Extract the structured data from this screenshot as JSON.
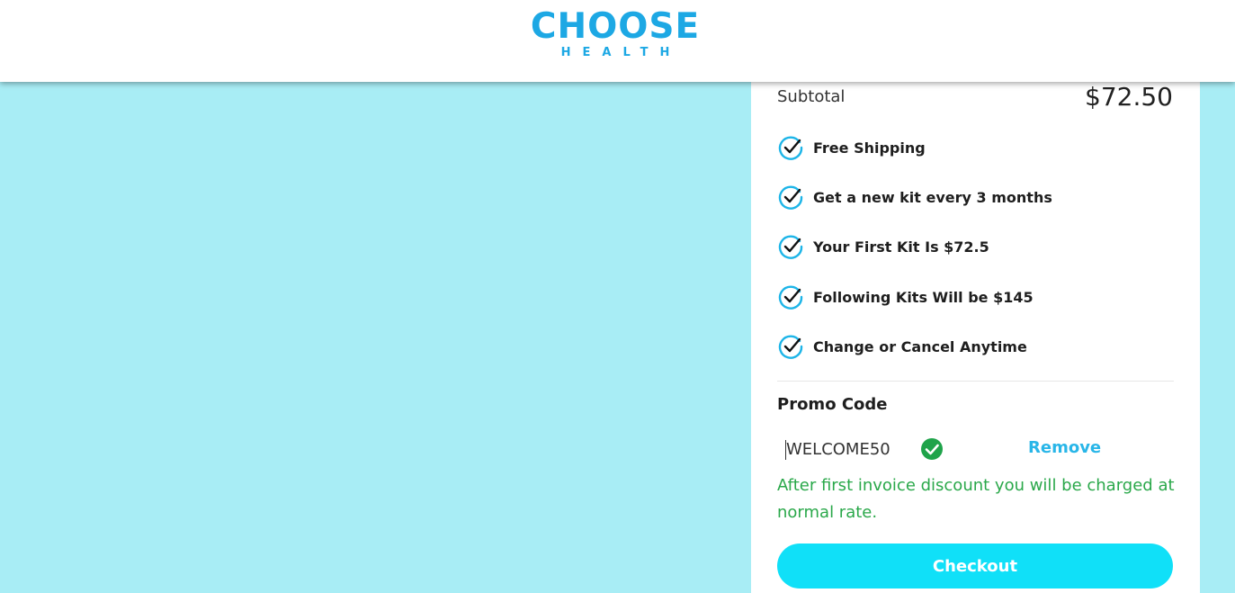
{
  "header": {
    "logo_text": "CHOOSE",
    "logo_subtext": "HEALTH"
  },
  "summary": {
    "subtotal_label": "Subtotal",
    "subtotal_value": "$72.50",
    "features": [
      {
        "label": "Free Shipping",
        "icon": "check-circle-icon"
      },
      {
        "label": "Get a new kit every 3 months",
        "icon": "check-circle-icon"
      },
      {
        "label": "Your First Kit Is $72.5",
        "icon": "check-circle-icon"
      },
      {
        "label": "Following Kits Will be $145",
        "icon": "check-circle-icon"
      },
      {
        "label": "Change or Cancel Anytime",
        "icon": "check-circle-icon"
      }
    ]
  },
  "promo": {
    "title": "Promo Code",
    "value": "WELCOME50",
    "valid_icon": "success-check-icon",
    "remove_label": "Remove",
    "note": "After first invoice discount you will be charged at normal rate."
  },
  "checkout": {
    "label": "Checkout"
  },
  "colors": {
    "page_background": "#a8edf5",
    "brand_blue": "#1da8e4",
    "checkout_button": "#10e0f8",
    "success_green": "#2aa84a",
    "link_blue": "#29b6e8"
  }
}
